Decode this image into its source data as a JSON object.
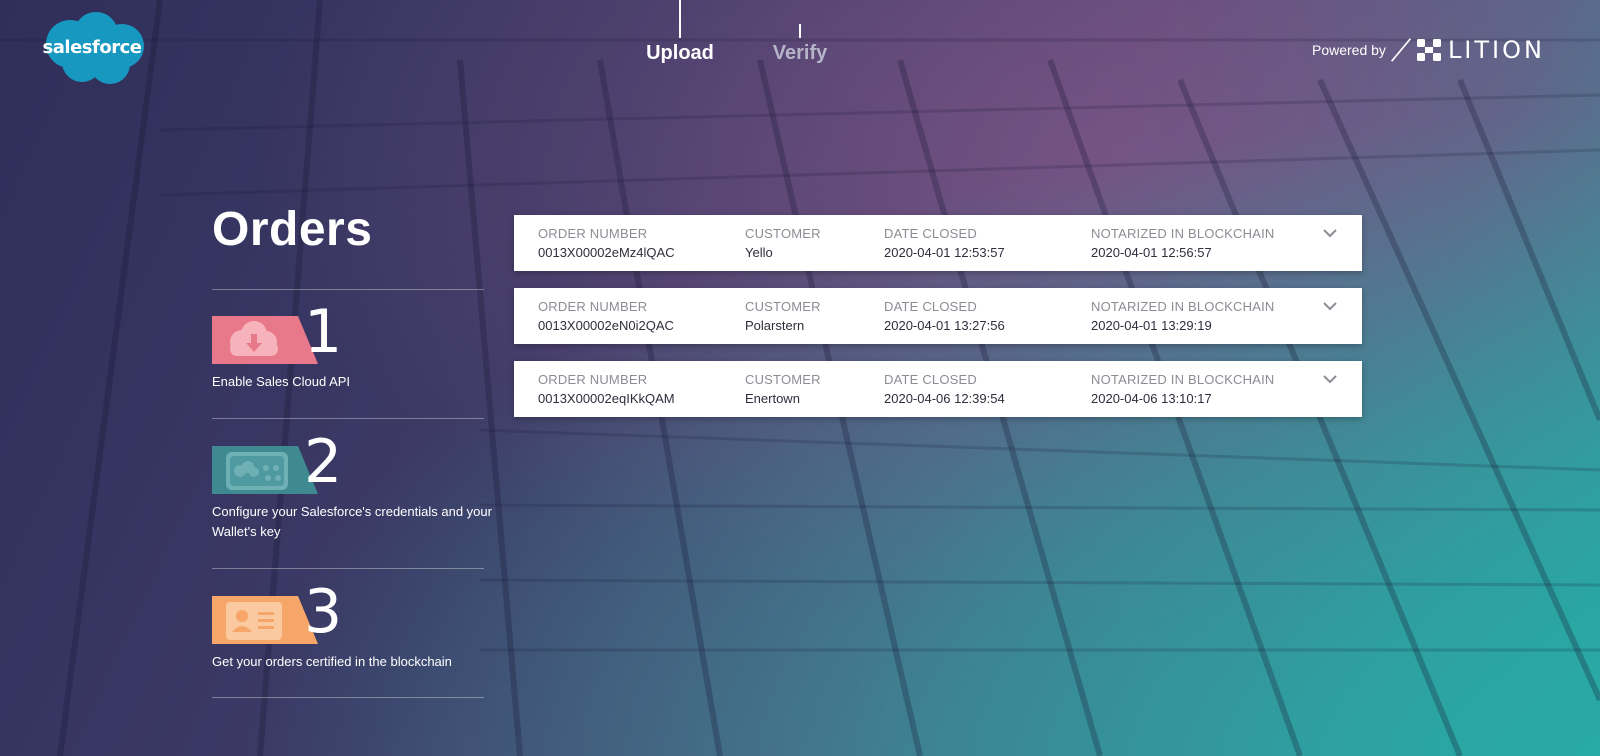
{
  "header": {
    "logo_text": "salesforce",
    "nav": [
      {
        "label": "Upload",
        "active": true
      },
      {
        "label": "Verify",
        "active": false
      }
    ],
    "powered_by": "Powered by",
    "partner_name": "LITION"
  },
  "sidebar": {
    "title": "Orders",
    "steps": [
      {
        "number": "1",
        "label": "Enable Sales Cloud API",
        "icon": "cloud-download-icon",
        "color": "#e8798a"
      },
      {
        "number": "2",
        "label": "Configure your Salesforce's credentials and your Wallet's key",
        "icon": "credentials-key-icon",
        "color": "#3f8a90"
      },
      {
        "number": "3",
        "label": "Get your orders certified in the blockchain",
        "icon": "id-card-icon",
        "color": "#f7a66a"
      }
    ]
  },
  "orders": {
    "columns": [
      "ORDER NUMBER",
      "CUSTOMER",
      "DATE CLOSED",
      "NOTARIZED IN BLOCKCHAIN"
    ],
    "rows": [
      {
        "order_number": "0013X00002eMz4lQAC",
        "customer": "Yello",
        "date_closed": "2020-04-01 12:53:57",
        "notarized": "2020-04-01 12:56:57"
      },
      {
        "order_number": "0013X00002eN0i2QAC",
        "customer": "Polarstern",
        "date_closed": "2020-04-01 13:27:56",
        "notarized": "2020-04-01 13:29:19"
      },
      {
        "order_number": "0013X00002eqIKkQAM",
        "customer": "Enertown",
        "date_closed": "2020-04-06 12:39:54",
        "notarized": "2020-04-06 13:10:17"
      }
    ]
  },
  "colors": {
    "accent_teal": "#2ba3a0",
    "bg_purple": "#3d3a66",
    "salesforce_blue": "#1798c1"
  }
}
